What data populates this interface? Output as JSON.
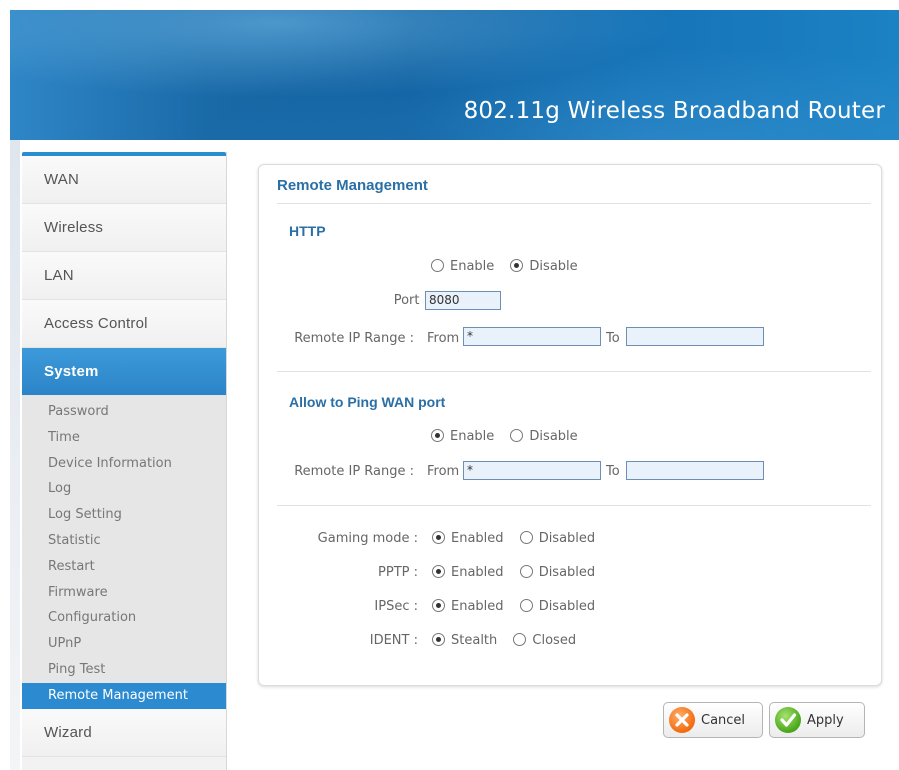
{
  "header": {
    "title": "802.11g Wireless Broadband Router"
  },
  "sidebar": {
    "items": [
      {
        "label": "WAN"
      },
      {
        "label": "Wireless"
      },
      {
        "label": "LAN"
      },
      {
        "label": "Access Control"
      },
      {
        "label": "System"
      },
      {
        "label": "Wizard"
      }
    ],
    "submenu": [
      "Password",
      "Time",
      "Device Information",
      "Log",
      "Log Setting",
      "Statistic",
      "Restart",
      "Firmware",
      "Configuration",
      "UPnP",
      "Ping Test",
      "Remote Management"
    ]
  },
  "panel": {
    "title": "Remote Management",
    "http": {
      "title": "HTTP",
      "enable_label": "Enable",
      "disable_label": "Disable",
      "selected": "Disable",
      "port_label": "Port :",
      "port_value": "8080",
      "range_label": "Remote IP Range :",
      "from_label": "From",
      "from_value": "*",
      "to_label": "To",
      "to_value": ""
    },
    "ping": {
      "title": "Allow to Ping WAN port",
      "enable_label": "Enable",
      "disable_label": "Disable",
      "selected": "Enable",
      "range_label": "Remote IP Range :",
      "from_label": "From",
      "from_value": "*",
      "to_label": "To",
      "to_value": ""
    },
    "options": {
      "gaming": {
        "label": "Gaming mode :",
        "on": "Enabled",
        "off": "Disabled",
        "selected": "Enabled"
      },
      "pptp": {
        "label": "PPTP :",
        "on": "Enabled",
        "off": "Disabled",
        "selected": "Enabled"
      },
      "ipsec": {
        "label": "IPSec :",
        "on": "Enabled",
        "off": "Disabled",
        "selected": "Enabled"
      },
      "ident": {
        "label": "IDENT :",
        "on": "Stealth",
        "off": "Closed",
        "selected": "Stealth"
      }
    }
  },
  "buttons": {
    "cancel": "Cancel",
    "apply": "Apply"
  },
  "colors": {
    "accent": "#2b8ad0",
    "title": "#2a6fa6",
    "header": "#1a6aa8"
  }
}
